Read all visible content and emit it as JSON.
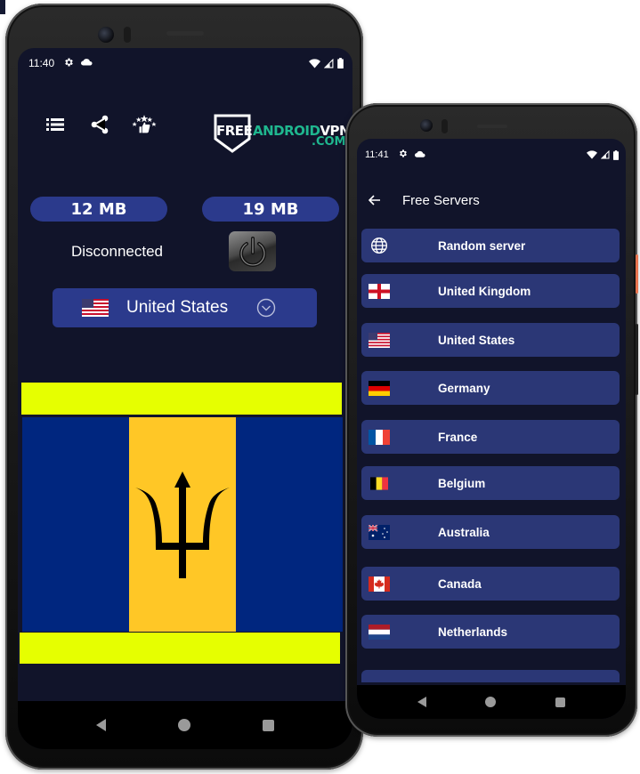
{
  "left_phone": {
    "status_bar": {
      "time": "11:40",
      "icons": [
        "gear-icon",
        "cloud-icon"
      ],
      "right_icons": [
        "wifi-icon",
        "signal-icon",
        "battery-icon"
      ]
    },
    "toolbar": {
      "icons": [
        "menu-list-icon",
        "share-icon",
        "rate-stars-icon"
      ]
    },
    "logo": {
      "free": "FREE",
      "android": "ANDROID",
      "vpn": "VPN",
      "com": ".COM"
    },
    "download_value": "12 MB",
    "upload_value": "19 MB",
    "connection_status": "Disconnected",
    "selected_country": {
      "name": "United States",
      "flag": "us-flag"
    },
    "banner_flag": "Barbados",
    "nav": [
      "back",
      "home",
      "recents"
    ]
  },
  "right_phone": {
    "status_bar": {
      "time": "11:41",
      "icons": [
        "gear-icon",
        "cloud-icon"
      ],
      "right_icons": [
        "wifi-icon",
        "signal-icon",
        "battery-icon"
      ]
    },
    "header": {
      "title": "Free Servers"
    },
    "servers": [
      {
        "name": "Random server",
        "icon": "globe"
      },
      {
        "name": "United Kingdom",
        "icon": "uk"
      },
      {
        "name": "United States",
        "icon": "us"
      },
      {
        "name": "Germany",
        "icon": "de"
      },
      {
        "name": "France",
        "icon": "fr"
      },
      {
        "name": "Belgium",
        "icon": "be"
      },
      {
        "name": "Australia",
        "icon": "au"
      },
      {
        "name": "Canada",
        "icon": "ca"
      },
      {
        "name": "Netherlands",
        "icon": "nl"
      }
    ],
    "nav": [
      "back",
      "home",
      "recents"
    ]
  },
  "colors": {
    "background": "#11142a",
    "accent_blue": "#2b3a8c",
    "list_item": "#2b3776",
    "logo_green": "#1fb78f",
    "banner_yellow": "#e6ff00",
    "barbados_blue": "#00267f",
    "barbados_gold": "#ffc726"
  }
}
